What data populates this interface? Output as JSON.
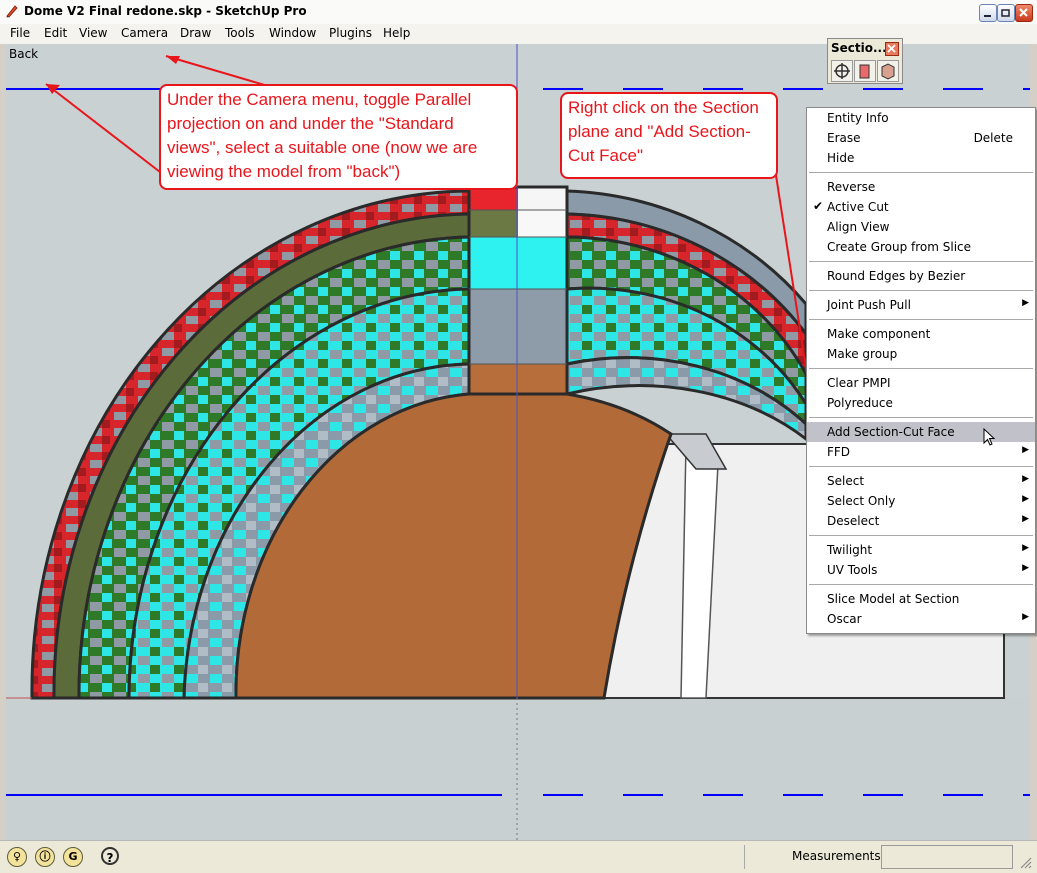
{
  "window": {
    "title": "Dome V2 Final redone.skp - SketchUp Pro"
  },
  "menubar": {
    "items": [
      "File",
      "Edit",
      "View",
      "Camera",
      "Draw",
      "Tools",
      "Window",
      "Plugins",
      "Help"
    ]
  },
  "view": {
    "label": "Back"
  },
  "section_toolbar": {
    "title": "Sectio..."
  },
  "callouts": {
    "camera": "Under the Camera menu, toggle Parallel projection on and under the \"Standard views\", select a suitable one (now we are viewing the model from \"back\")",
    "section": "Right click on the Section plane and \"Add Section-Cut Face\""
  },
  "context_menu": {
    "items": [
      {
        "label": "Entity Info"
      },
      {
        "label": "Erase",
        "shortcut": "Delete"
      },
      {
        "label": "Hide"
      },
      {
        "label": "Reverse"
      },
      {
        "label": "Active Cut",
        "checked": "✔"
      },
      {
        "label": "Align View"
      },
      {
        "label": "Create Group from Slice"
      },
      {
        "label": "Round Edges by Bezier"
      },
      {
        "label": "Joint Push Pull",
        "submenu": "▶"
      },
      {
        "label": "Make component"
      },
      {
        "label": "Make group"
      },
      {
        "label": "Clear PMPI"
      },
      {
        "label": "Polyreduce"
      },
      {
        "label": "Add Section-Cut Face",
        "highlighted": true
      },
      {
        "label": "FFD",
        "submenu": "▶"
      },
      {
        "label": "Select",
        "submenu": "▶"
      },
      {
        "label": "Select Only",
        "submenu": "▶"
      },
      {
        "label": "Deselect",
        "submenu": "▶"
      },
      {
        "label": "Twilight",
        "submenu": "▶"
      },
      {
        "label": "UV Tools",
        "submenu": "▶"
      },
      {
        "label": "Slice Model at Section"
      },
      {
        "label": "Oscar",
        "submenu": "▶"
      }
    ]
  },
  "statusbar": {
    "icons": [
      {
        "name": "geo-location-icon",
        "glyph": "♀"
      },
      {
        "name": "credits-icon",
        "glyph": "ⓘ"
      },
      {
        "name": "google-sign-in-icon",
        "glyph": "G"
      }
    ],
    "help_glyph": "?",
    "measurements_label": "Measurements",
    "measurements_value": ""
  },
  "colors": {
    "callout_red": "#e8151b",
    "section_line_blue": "#0000ff",
    "red_shell": "#d7252c",
    "green_shell": "#2f7a28",
    "cyan_shell": "#2ee6e6",
    "gray_shell": "#8a9aa8",
    "core_brown": "#b26a39"
  }
}
